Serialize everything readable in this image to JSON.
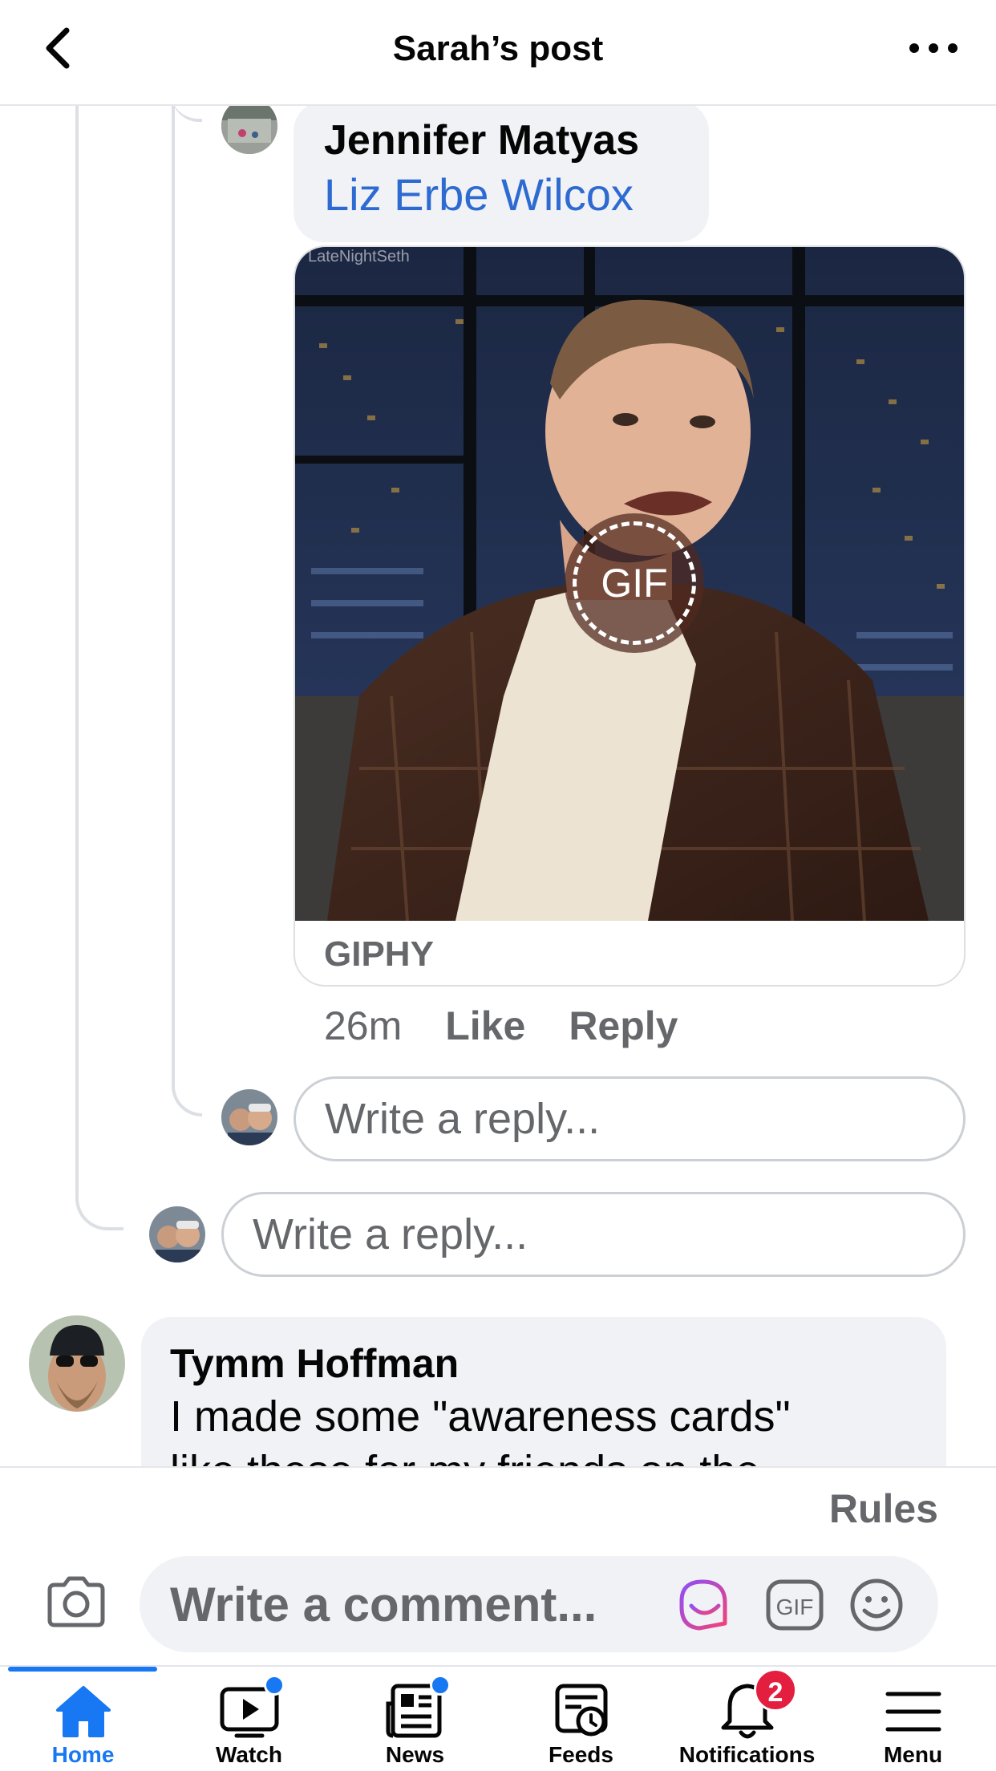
{
  "header": {
    "title": "Sarah’s post"
  },
  "reply_comment": {
    "author": "Jennifer Matyas",
    "mention": "Liz Erbe Wilcox",
    "gif": {
      "watermark": "LateNightSeth",
      "badge": "GIF",
      "source": "GIPHY"
    },
    "time": "26m",
    "like_label": "Like",
    "reply_label": "Reply"
  },
  "nested_reply_input": {
    "placeholder": "Write a reply..."
  },
  "thread_reply_input": {
    "placeholder": "Write a reply..."
  },
  "next_comment": {
    "author": "Tymm Hoffman",
    "text_line1": "I made some \"awareness cards\"",
    "text_line2": "like these for my friends on the"
  },
  "composer": {
    "rules_label": "Rules",
    "placeholder": "Write a comment...",
    "gif_label": "GIF"
  },
  "tabbar": {
    "tabs": [
      {
        "label": "Home",
        "active": true
      },
      {
        "label": "Watch",
        "dot": true
      },
      {
        "label": "News",
        "dot": true
      },
      {
        "label": "Feeds"
      },
      {
        "label": "Notifications",
        "badge": "2"
      },
      {
        "label": "Menu"
      }
    ]
  },
  "colors": {
    "accent": "#1877f2",
    "mention": "#2d6ad1",
    "bubble": "#f0f2f5",
    "muted_text": "#65676b",
    "badge_red": "#e41e3f"
  }
}
